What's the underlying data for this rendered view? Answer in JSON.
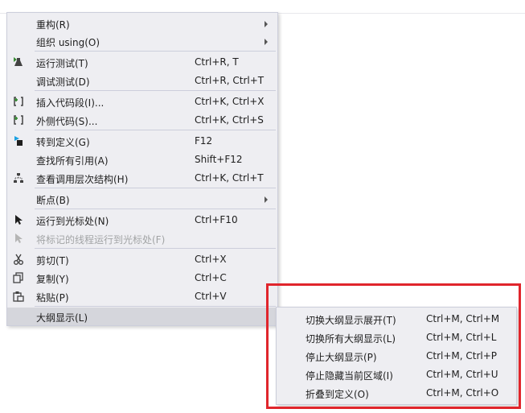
{
  "menu": {
    "items": [
      {
        "label": "重构(R)",
        "shortcut": "",
        "submenu": true
      },
      {
        "label": "组织 using(O)",
        "shortcut": "",
        "submenu": true
      },
      {
        "label": "运行测试(T)",
        "shortcut": "Ctrl+R, T",
        "icon": "flask-run-icon"
      },
      {
        "label": "调试测试(D)",
        "shortcut": "Ctrl+R, Ctrl+T"
      },
      {
        "label": "插入代码段(I)...",
        "shortcut": "Ctrl+K, Ctrl+X",
        "icon": "insert-snippet-icon"
      },
      {
        "label": "外侧代码(S)...",
        "shortcut": "Ctrl+K, Ctrl+S",
        "icon": "surround-with-icon"
      },
      {
        "label": "转到定义(G)",
        "shortcut": "F12",
        "icon": "go-to-definition-icon"
      },
      {
        "label": "查找所有引用(A)",
        "shortcut": "Shift+F12"
      },
      {
        "label": "查看调用层次结构(H)",
        "shortcut": "Ctrl+K, Ctrl+T",
        "icon": "call-hierarchy-icon"
      },
      {
        "label": "断点(B)",
        "shortcut": "",
        "submenu": true
      },
      {
        "label": "运行到光标处(N)",
        "shortcut": "Ctrl+F10",
        "icon": "run-to-cursor-icon"
      },
      {
        "label": "将标记的线程运行到光标处(F)",
        "shortcut": "",
        "disabled": true,
        "icon": "run-flagged-threads-icon"
      },
      {
        "label": "剪切(T)",
        "shortcut": "Ctrl+X",
        "icon": "scissors-icon"
      },
      {
        "label": "复制(Y)",
        "shortcut": "Ctrl+C",
        "icon": "copy-icon"
      },
      {
        "label": "粘贴(P)",
        "shortcut": "Ctrl+V",
        "icon": "paste-icon"
      },
      {
        "label": "大纲显示(L)",
        "shortcut": "",
        "highlighted": true
      }
    ]
  },
  "submenu": {
    "items": [
      {
        "label": "切换大纲显示展开(T)",
        "shortcut": "Ctrl+M, Ctrl+M"
      },
      {
        "label": "切换所有大纲显示(L)",
        "shortcut": "Ctrl+M, Ctrl+L"
      },
      {
        "label": "停止大纲显示(P)",
        "shortcut": "Ctrl+M, Ctrl+P"
      },
      {
        "label": "停止隐藏当前区域(I)",
        "shortcut": "Ctrl+M, Ctrl+U"
      },
      {
        "label": "折叠到定义(O)",
        "shortcut": "Ctrl+M, Ctrl+O"
      }
    ]
  },
  "colors": {
    "highlight": "#d5d6dc",
    "menu_bg": "#eeeef2",
    "annotation_box": "#e0252c"
  }
}
